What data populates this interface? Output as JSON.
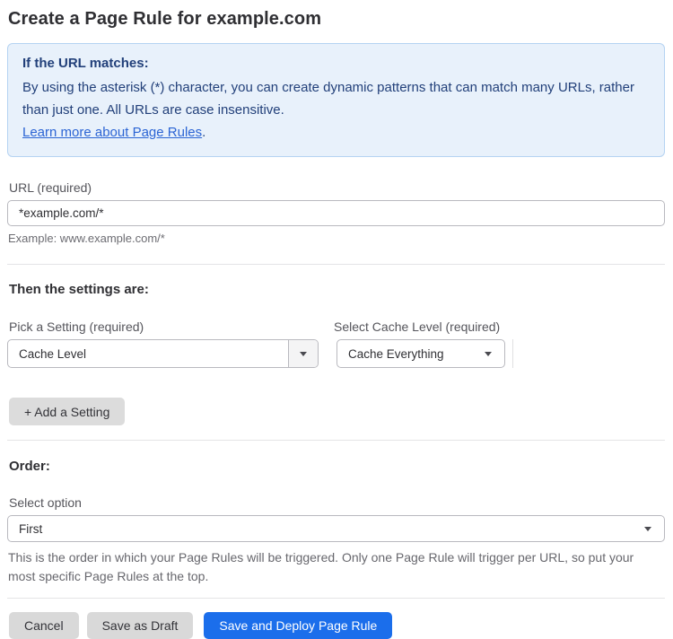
{
  "page": {
    "title": "Create a Page Rule for example.com"
  },
  "info_box": {
    "heading": "If the URL matches:",
    "body": "By using the asterisk (*) character, you can create dynamic patterns that can match many URLs, rather than just one. All URLs are case insensitive.",
    "link_text": "Learn more about Page Rules",
    "link_suffix": "."
  },
  "url_field": {
    "label": "URL (required)",
    "value": "*example.com/*",
    "hint": "Example: www.example.com/*"
  },
  "settings_section": {
    "heading": "Then the settings are:",
    "setting_select": {
      "label": "Pick a Setting (required)",
      "value": "Cache Level"
    },
    "cache_level_select": {
      "label": "Select Cache Level (required)",
      "value": "Cache Everything"
    },
    "add_setting_button": "+ Add a Setting"
  },
  "order_section": {
    "heading": "Order:",
    "select_label": "Select option",
    "select_value": "First",
    "description": "This is the order in which your Page Rules will be triggered. Only one Page Rule will trigger per URL, so put your most specific Page Rules at the top."
  },
  "footer": {
    "cancel_label": "Cancel",
    "save_draft_label": "Save as Draft",
    "save_deploy_label": "Save and Deploy Page Rule"
  },
  "colors": {
    "primary_button_bg": "#1b6eeb",
    "secondary_button_bg": "#d9d9d9",
    "info_box_bg": "#e8f1fb",
    "info_box_border": "#b5d3f2",
    "info_text": "#22407a",
    "link": "#2b64d4"
  },
  "icons": {
    "dropdown_arrow": "caret-down"
  }
}
